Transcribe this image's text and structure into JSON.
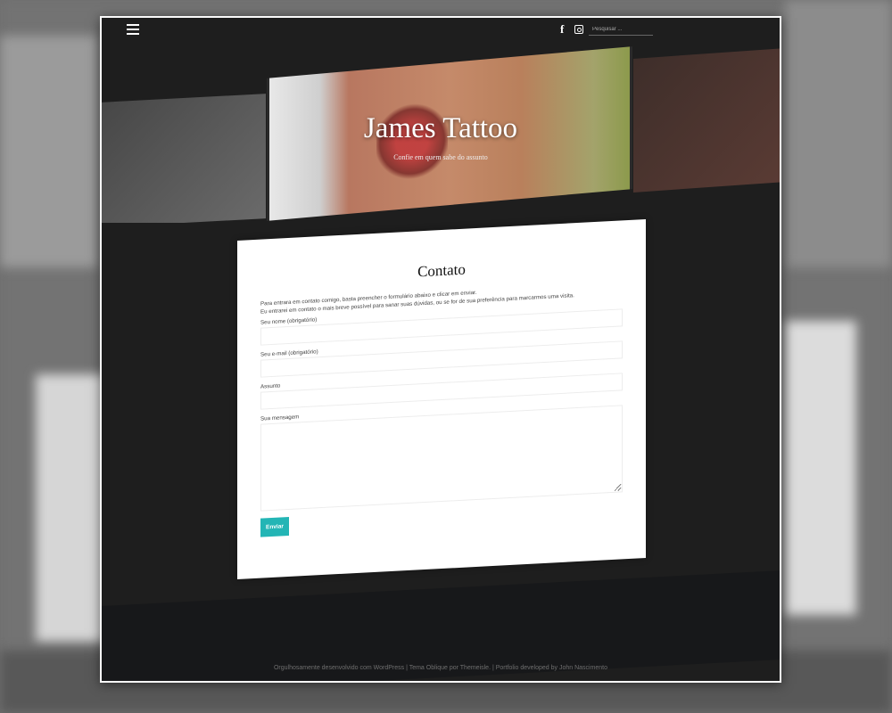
{
  "site": {
    "title": "James Tattoo",
    "tagline": "Confie em quem sabe do assunto"
  },
  "topbar": {
    "menu_icon": "hamburger-icon",
    "social": [
      {
        "name": "facebook-icon",
        "glyph": "f"
      },
      {
        "name": "instagram-icon",
        "glyph": ""
      }
    ],
    "search_placeholder": "Pesquisar ..."
  },
  "contact": {
    "heading": "Contato",
    "intro_line1": "Para entrara em contato comigo, basta preencher o formulário abaixo e clicar em enviar.",
    "intro_line2": "Eu entrarei em contato o mais breve possível para sanar suas dúvidas, ou se for de sua preferência para marcarmos uma visita.",
    "fields": {
      "name_label": "Seu nome (obrigatório)",
      "email_label": "Seu e-mail (obrigatório)",
      "subject_label": "Assunto",
      "message_label": "Sua mensagem"
    },
    "submit_label": "Enviar"
  },
  "footer": {
    "text": "Orgulhosamente desenvolvido com WordPress | Tema Oblique por Themeisle. | Portfolio developed by John Nascimento"
  },
  "colors": {
    "accent": "#23b5b5",
    "background": "#1e1e1e"
  }
}
